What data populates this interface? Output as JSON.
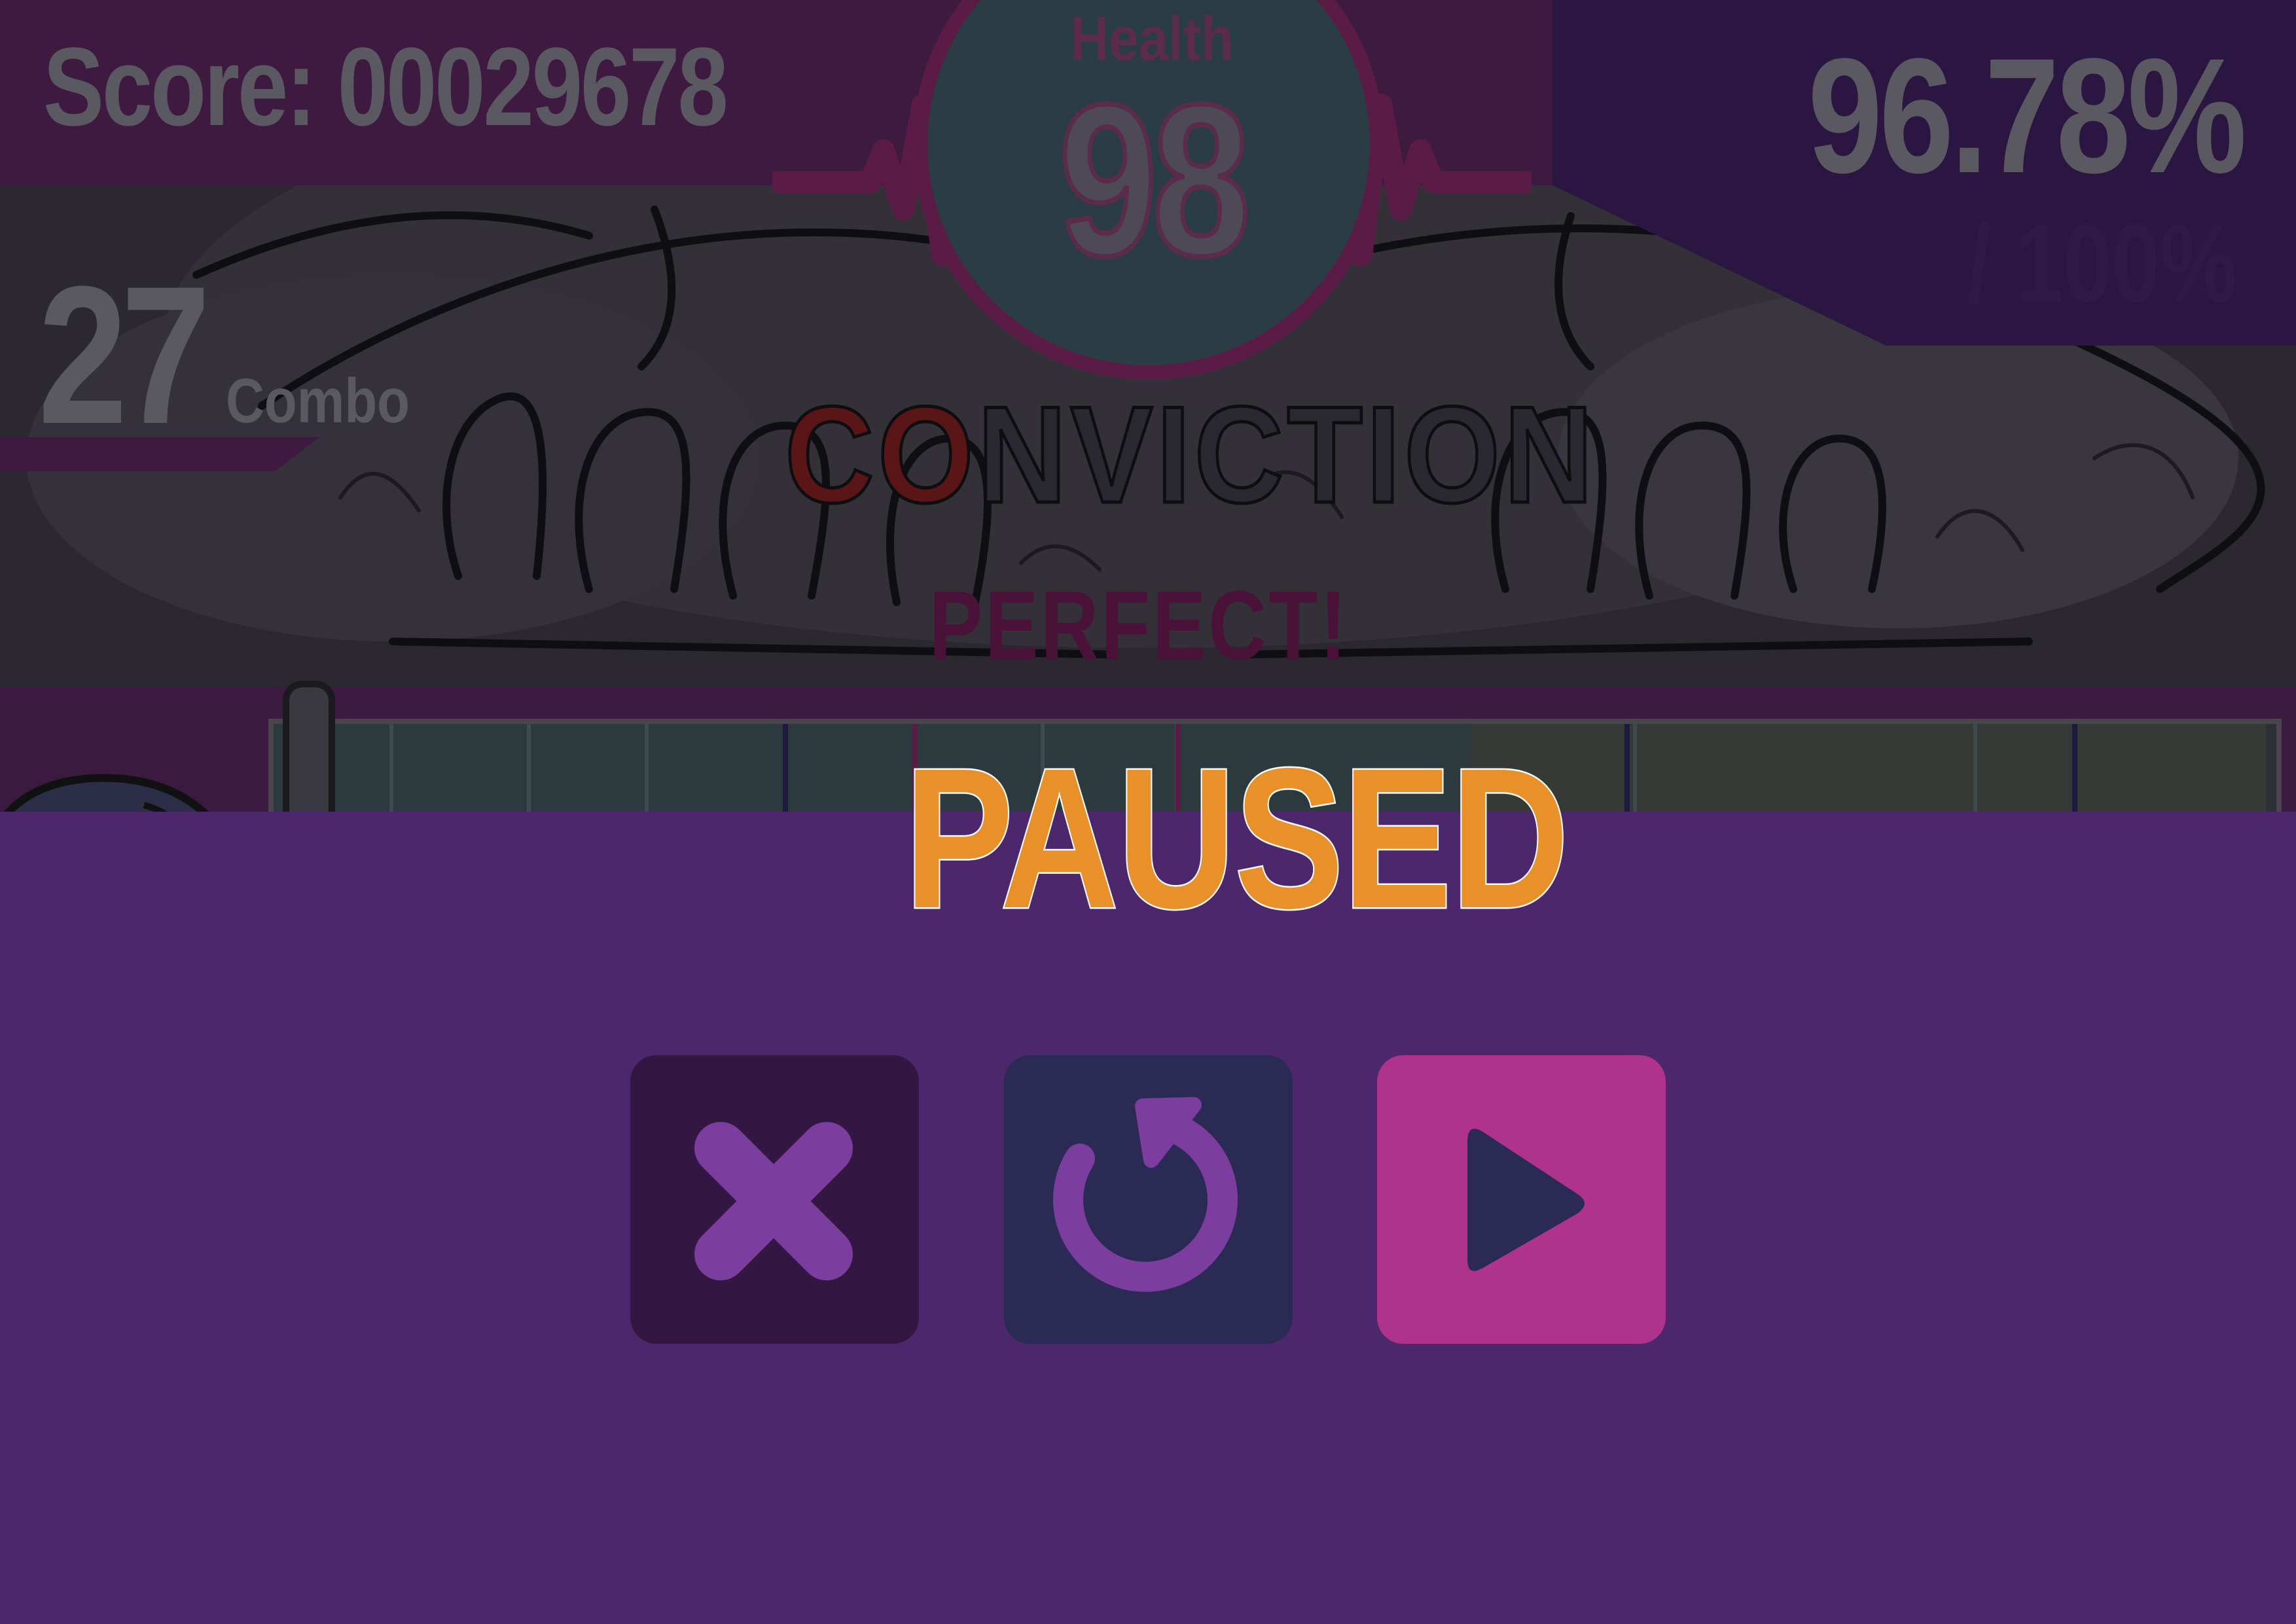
{
  "hud": {
    "score_text": "Score: 00029678",
    "health_label": "Health",
    "health_value": "98",
    "accuracy_value": "96.78%",
    "accuracy_max": "/ 100%",
    "combo_count": "27",
    "combo_label": "Combo"
  },
  "song": {
    "title_highlight": "CO",
    "title_rest": "NVICTION",
    "judgement": "PERFECT!"
  },
  "pause_menu": {
    "title": "PAUSED",
    "buttons": [
      {
        "action": "quit",
        "icon": "close-icon"
      },
      {
        "action": "restart",
        "icon": "restart-icon"
      },
      {
        "action": "resume",
        "icon": "play-icon"
      }
    ]
  },
  "colors": {
    "overlay": "#4d276b",
    "paused_title": "#e8902a",
    "quit_button": "#331742",
    "restart_button": "#2b2a54",
    "resume_button": "#af338c",
    "icon_purple": "#7c3e9e",
    "play_glyph": "#2b2a54"
  }
}
